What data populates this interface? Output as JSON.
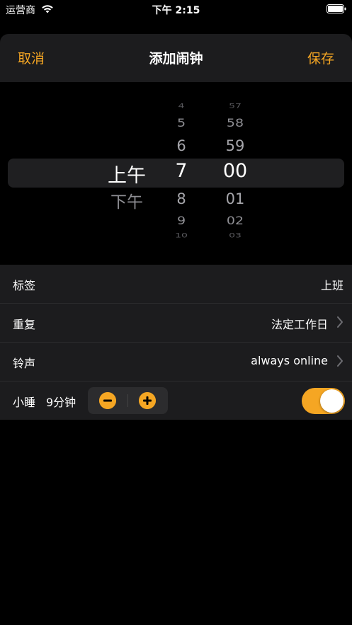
{
  "status_bar": {
    "carrier": "运营商",
    "time": "下午 2:15"
  },
  "nav": {
    "cancel": "取消",
    "title": "添加闹钟",
    "save": "保存"
  },
  "picker": {
    "ampm": {
      "selected": "上午",
      "other": "下午"
    },
    "hours": {
      "above": [
        "4",
        "5",
        "6"
      ],
      "selected": "7",
      "below": [
        "8",
        "9",
        "10"
      ]
    },
    "minutes": {
      "above": [
        "57",
        "58",
        "59"
      ],
      "selected": "00",
      "below": [
        "01",
        "02",
        "03"
      ]
    }
  },
  "settings": {
    "label": {
      "title": "标签",
      "value": "上班"
    },
    "repeat": {
      "title": "重复",
      "value": "法定工作日"
    },
    "ringtone": {
      "title": "铃声",
      "value": "always online"
    },
    "snooze": {
      "title": "小睡",
      "duration": "9分钟",
      "enabled": true
    }
  },
  "colors": {
    "accent": "#f5a623",
    "background": "#000000",
    "row_bg": "#1c1c1e"
  },
  "icons": {
    "wifi": "wifi-icon",
    "battery": "battery-icon",
    "chevron": "chevron-right-icon",
    "minus": "minus-circle-icon",
    "plus": "plus-circle-icon"
  }
}
